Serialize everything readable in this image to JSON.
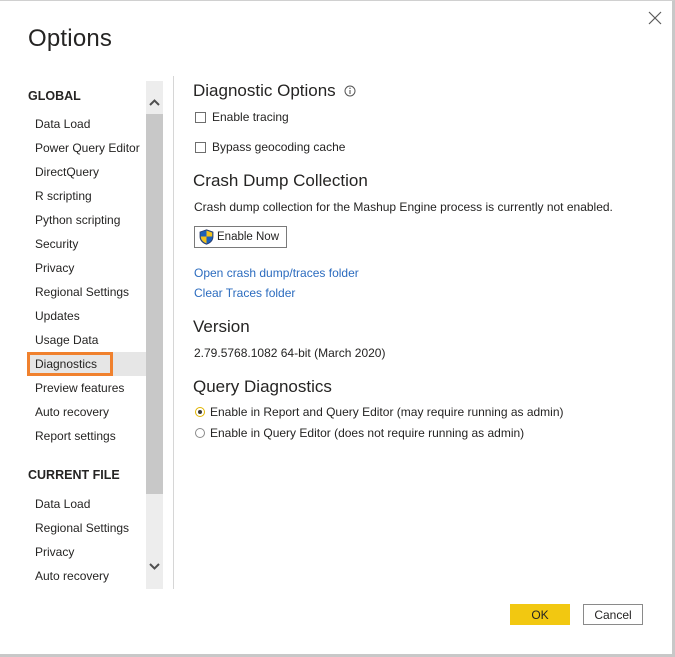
{
  "dialog": {
    "title": "Options",
    "close_icon": "close-icon"
  },
  "sidebar": {
    "global_header": "GLOBAL",
    "global_items": [
      {
        "label": "Data Load"
      },
      {
        "label": "Power Query Editor"
      },
      {
        "label": "DirectQuery"
      },
      {
        "label": "R scripting"
      },
      {
        "label": "Python scripting"
      },
      {
        "label": "Security"
      },
      {
        "label": "Privacy"
      },
      {
        "label": "Regional Settings"
      },
      {
        "label": "Updates"
      },
      {
        "label": "Usage Data"
      },
      {
        "label": "Diagnostics",
        "selected": true
      },
      {
        "label": "Preview features"
      },
      {
        "label": "Auto recovery"
      },
      {
        "label": "Report settings"
      }
    ],
    "current_file_header": "CURRENT FILE",
    "current_file_items": [
      {
        "label": "Data Load"
      },
      {
        "label": "Regional Settings"
      },
      {
        "label": "Privacy"
      },
      {
        "label": "Auto recovery"
      }
    ],
    "highlight_color": "#f0812e"
  },
  "main": {
    "diagnostic_options": {
      "heading": "Diagnostic Options",
      "info_icon": "info-icon",
      "enable_tracing": {
        "label": "Enable tracing",
        "checked": false
      },
      "bypass_geocoding": {
        "label": "Bypass geocoding cache",
        "checked": false
      }
    },
    "crash_dump": {
      "heading": "Crash Dump Collection",
      "description": "Crash dump collection for the Mashup Engine process is currently not enabled.",
      "enable_now_label": "Enable Now",
      "enable_now_icon": "uac-shield-icon",
      "open_folder_link": "Open crash dump/traces folder",
      "clear_traces_link": "Clear Traces folder"
    },
    "version": {
      "heading": "Version",
      "value": "2.79.5768.1082 64-bit (March 2020)"
    },
    "query_diagnostics": {
      "heading": "Query Diagnostics",
      "options": [
        {
          "label": "Enable in Report and Query Editor (may require running as admin)",
          "selected": true
        },
        {
          "label": "Enable in Query Editor (does not require running as admin)",
          "selected": false
        }
      ]
    }
  },
  "footer": {
    "ok_label": "OK",
    "cancel_label": "Cancel",
    "ok_color": "#f2c811"
  }
}
